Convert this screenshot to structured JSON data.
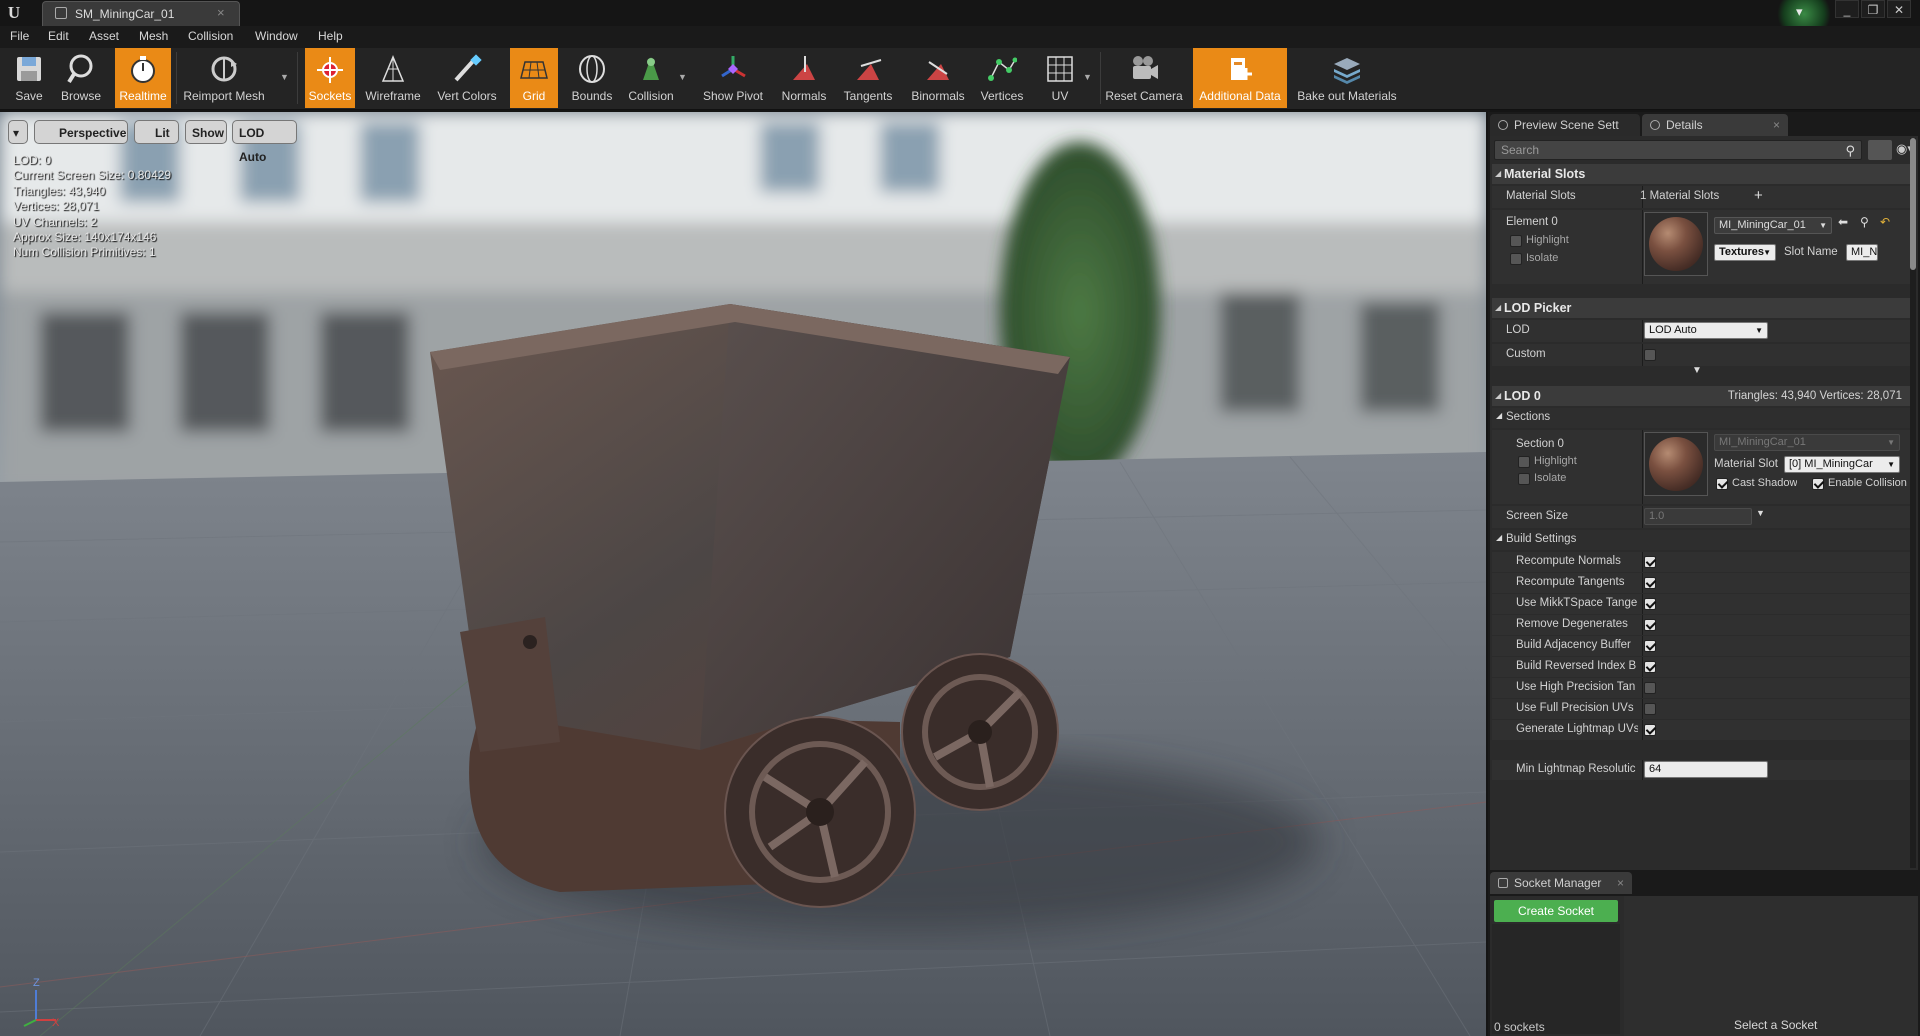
{
  "window": {
    "tab_title": "SM_MiningCar_01",
    "logo_text": "U",
    "controls": [
      "_",
      "❐",
      "✕"
    ]
  },
  "menubar": [
    "File",
    "Edit",
    "Asset",
    "Mesh",
    "Collision",
    "Window",
    "Help"
  ],
  "toolbar": [
    {
      "label": "Save",
      "icon": "save-icon",
      "active": false
    },
    {
      "label": "Browse",
      "icon": "browse-icon",
      "active": false
    },
    {
      "label": "Realtime",
      "icon": "realtime-icon",
      "active": true
    },
    {
      "label": "Reimport Mesh",
      "icon": "reimport-icon",
      "active": false
    },
    {
      "label": "Sockets",
      "icon": "sockets-icon",
      "active": true
    },
    {
      "label": "Wireframe",
      "icon": "wireframe-icon",
      "active": false
    },
    {
      "label": "Vert Colors",
      "icon": "vert-colors-icon",
      "active": false
    },
    {
      "label": "Grid",
      "icon": "grid-icon",
      "active": true
    },
    {
      "label": "Bounds",
      "icon": "bounds-icon",
      "active": false
    },
    {
      "label": "Collision",
      "icon": "collision-icon",
      "active": false
    },
    {
      "label": "Show Pivot",
      "icon": "pivot-icon",
      "active": false
    },
    {
      "label": "Normals",
      "icon": "normals-icon",
      "active": false
    },
    {
      "label": "Tangents",
      "icon": "tangents-icon",
      "active": false
    },
    {
      "label": "Binormals",
      "icon": "binormals-icon",
      "active": false
    },
    {
      "label": "Vertices",
      "icon": "vertices-icon",
      "active": false
    },
    {
      "label": "UV",
      "icon": "uv-icon",
      "active": false
    },
    {
      "label": "Reset Camera",
      "icon": "camera-icon",
      "active": false
    },
    {
      "label": "Additional Data",
      "icon": "additional-data-icon",
      "active": true
    },
    {
      "label": "Bake out Materials",
      "icon": "bake-icon",
      "active": false
    }
  ],
  "viewport": {
    "buttons": {
      "menu": "▾",
      "perspective": "Perspective",
      "lit": "Lit",
      "show": "Show",
      "lod": "LOD Auto"
    },
    "stats": [
      "LOD:  0",
      "Current Screen Size:  0.80429",
      "Triangles:  43,940",
      "Vertices:  28,071",
      "UV Channels:  2",
      "Approx Size: 140x174x146",
      "Num Collision Primitives:  1"
    ],
    "axis": {
      "z": "Z",
      "x": "X"
    }
  },
  "panel": {
    "tabs": {
      "preview": "Preview Scene Sett",
      "details": "Details"
    },
    "search_placeholder": "Search",
    "material_slots": {
      "title": "Material Slots",
      "label": "Material Slots",
      "count": "1 Material Slots",
      "element": "Element 0",
      "highlight": "Highlight",
      "isolate": "Isolate",
      "material": "MI_MiningCar_01",
      "textures": "Textures",
      "slot_name_label": "Slot Name",
      "slot_name_value": "MI_N"
    },
    "lod_picker": {
      "title": "LOD Picker",
      "lod_label": "LOD",
      "lod_value": "LOD Auto",
      "custom_label": "Custom"
    },
    "lod0": {
      "title": "LOD 0",
      "stats": "Triangles: 43,940   Vertices: 28,071",
      "sections": "Sections",
      "section0": "Section 0",
      "highlight": "Highlight",
      "isolate": "Isolate",
      "material": "MI_MiningCar_01",
      "material_slot_label": "Material Slot",
      "material_slot_value": "[0] MI_MiningCar",
      "cast_shadow": "Cast Shadow",
      "enable_collision": "Enable Collision",
      "screen_size_label": "Screen Size",
      "screen_size_value": "1.0",
      "build_settings": "Build Settings",
      "build_rows": [
        {
          "label": "Recompute Normals",
          "checked": true
        },
        {
          "label": "Recompute Tangents",
          "checked": true
        },
        {
          "label": "Use MikkTSpace Tange",
          "checked": true
        },
        {
          "label": "Remove Degenerates",
          "checked": true
        },
        {
          "label": "Build Adjacency Buffer",
          "checked": true
        },
        {
          "label": "Build Reversed Index B",
          "checked": true
        },
        {
          "label": "Use High Precision Tan",
          "checked": false
        },
        {
          "label": "Use Full Precision UVs",
          "checked": false
        },
        {
          "label": "Generate Lightmap UVs",
          "checked": true
        }
      ],
      "min_lightmap_label": "Min Lightmap Resolutic",
      "min_lightmap_value": "64"
    },
    "socket_manager": {
      "tab": "Socket Manager",
      "create": "Create Socket",
      "select": "Select a Socket",
      "count": "0 sockets"
    }
  },
  "colors": {
    "accent": "#ea8a16",
    "create": "#4caf50",
    "panel": "#2b2b2b",
    "category": "#3b3b3b"
  }
}
